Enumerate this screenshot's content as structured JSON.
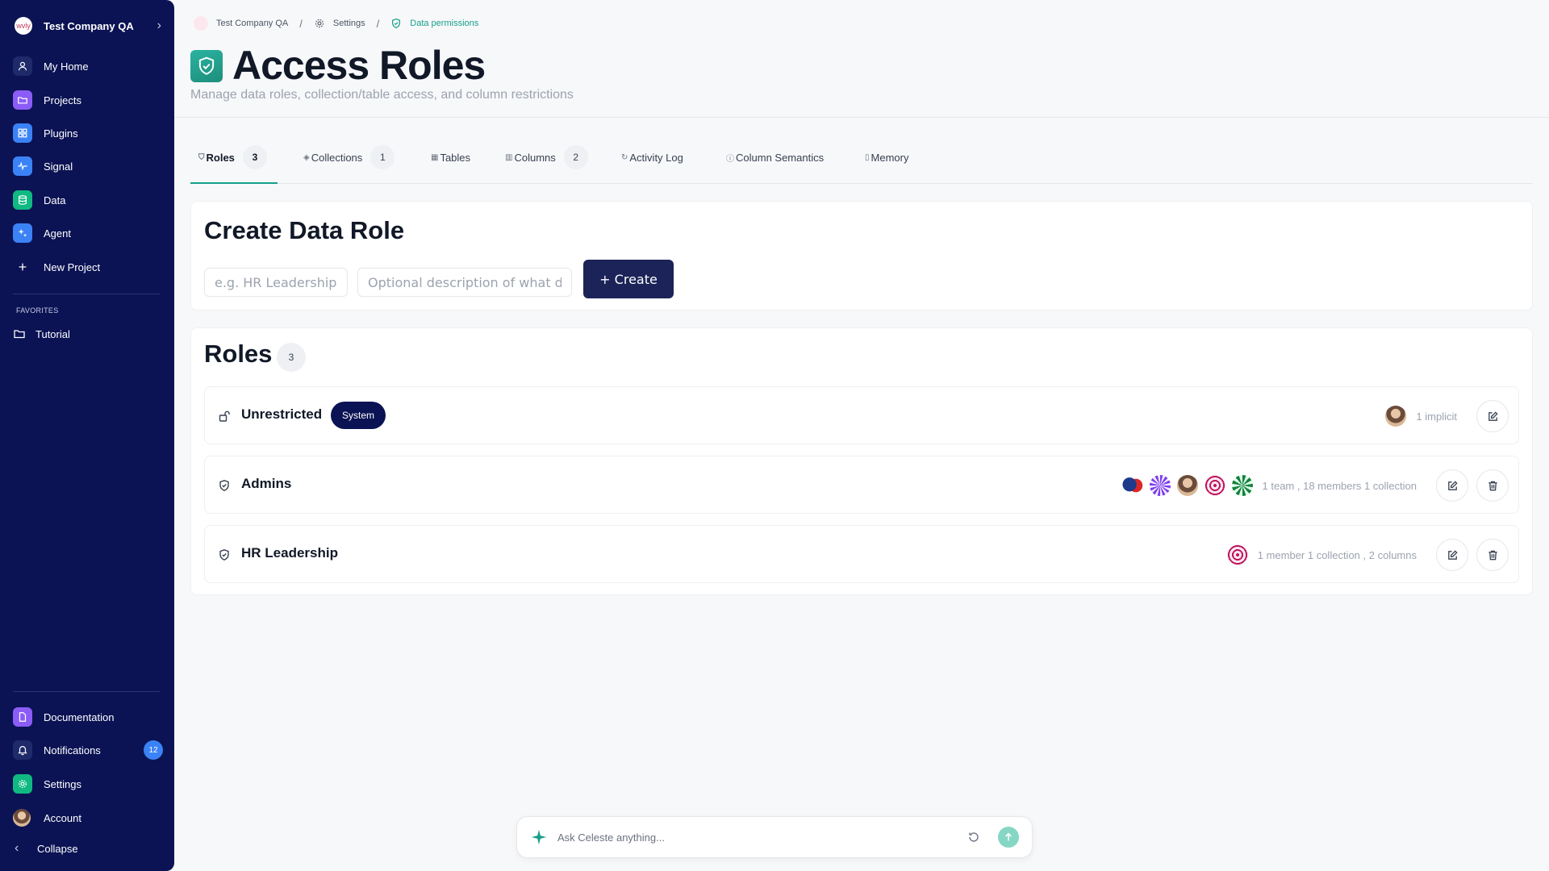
{
  "sidebar": {
    "org_name": "Test Company QA",
    "org_logo_text": "wvly",
    "items": [
      {
        "label": "My Home",
        "icon": "user-icon",
        "color": "#1f2a6b"
      },
      {
        "label": "Projects",
        "icon": "folder-icon",
        "color": "#8b5cf6"
      },
      {
        "label": "Plugins",
        "icon": "grid-icon",
        "color": "#3b82f6"
      },
      {
        "label": "Signal",
        "icon": "pulse-icon",
        "color": "#3b82f6"
      },
      {
        "label": "Data",
        "icon": "database-icon",
        "color": "#10b981"
      },
      {
        "label": "Agent",
        "icon": "sparkles-icon",
        "color": "#3b82f6"
      },
      {
        "label": "New Project",
        "icon": "plus-icon",
        "color": "transparent"
      }
    ],
    "favorites_title": "FAVORITES",
    "favorites": [
      {
        "label": "Tutorial",
        "icon": "folder-icon"
      }
    ],
    "bottom": {
      "documentation": "Documentation",
      "notifications": "Notifications",
      "notifications_count": "12",
      "settings": "Settings",
      "account": "Account",
      "collapse": "Collapse"
    }
  },
  "breadcrumb": {
    "org": "Test Company QA",
    "settings": "Settings",
    "current": "Data permissions"
  },
  "header": {
    "title": "Access Roles",
    "subtitle": "Manage data roles, collection/table access, and column restrictions"
  },
  "tabs": [
    {
      "label": "Roles",
      "count": "3",
      "active": true
    },
    {
      "label": "Collections",
      "count": "1"
    },
    {
      "label": "Tables"
    },
    {
      "label": "Columns",
      "count": "2"
    },
    {
      "label": "Activity Log"
    },
    {
      "label": "Column Semantics"
    },
    {
      "label": "Memory"
    }
  ],
  "create_card": {
    "title": "Create Data Role",
    "name_placeholder": "e.g. HR Leadership, Finance Team",
    "description_placeholder": "Optional description of what data this role can access",
    "create_label": "+ Create"
  },
  "roles_card": {
    "title": "Roles",
    "count": "3",
    "roles": [
      {
        "name": "Unrestricted",
        "badge": "System",
        "meta": "1 implicit"
      },
      {
        "name": "Admins",
        "meta": "1 team , 18 members 1 collection"
      },
      {
        "name": "HR Leadership",
        "meta": "1 member 1 collection , 2 columns"
      }
    ]
  },
  "ask": {
    "placeholder": "Ask Celeste anything..."
  },
  "colors": {
    "sidebar_bg": "#0b1354",
    "accent": "#179e8a",
    "primary_button": "#1b2358"
  }
}
